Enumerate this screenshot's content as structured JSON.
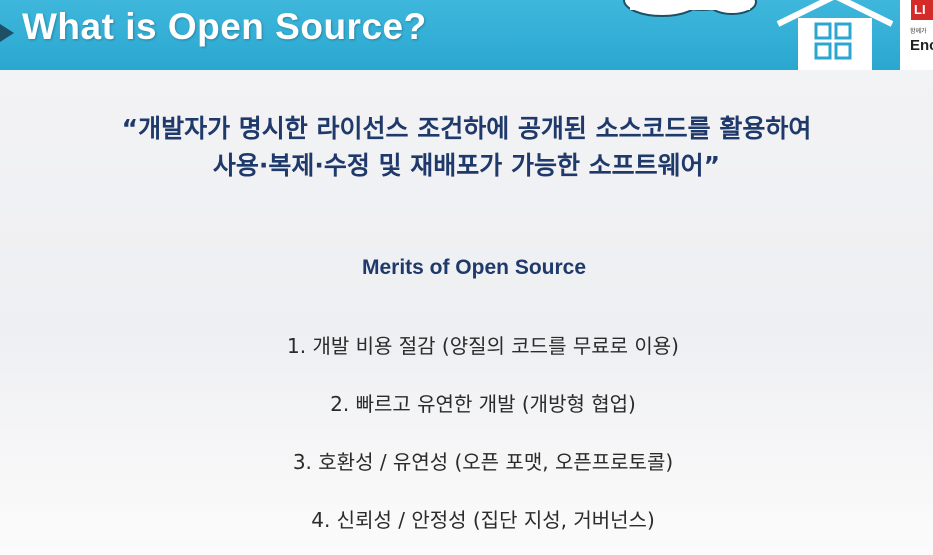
{
  "header": {
    "title": "What is Open Source?",
    "brand_red_text": "LI",
    "brand_small_text": "함께가",
    "brand_big_text": "Enc"
  },
  "colors": {
    "header_bar": "#2aa7d0",
    "heading_text": "#1f3a6a",
    "body_text": "#2b2b2b",
    "brand_red": "#d42a2a"
  },
  "definition": {
    "line1": "“개발자가 명시한 라이선스 조건하에 공개된 소스코드를 활용하여",
    "line2": "사용·복제·수정 및 재배포가 가능한 소프트웨어”"
  },
  "merits": {
    "heading": "Merits of Open Source",
    "items": [
      "1. 개발 비용 절감 (양질의 코드를 무료로 이용)",
      "2. 빠르고 유연한 개발 (개방형 협업)",
      "3. 호환성 / 유연성 (오픈 포맷, 오픈프로토콜)",
      "4. 신뢰성 / 안정성 (집단 지성, 거버넌스)"
    ]
  },
  "icons": [
    "arrow-marker-icon",
    "cloud-icon",
    "house-icon"
  ]
}
